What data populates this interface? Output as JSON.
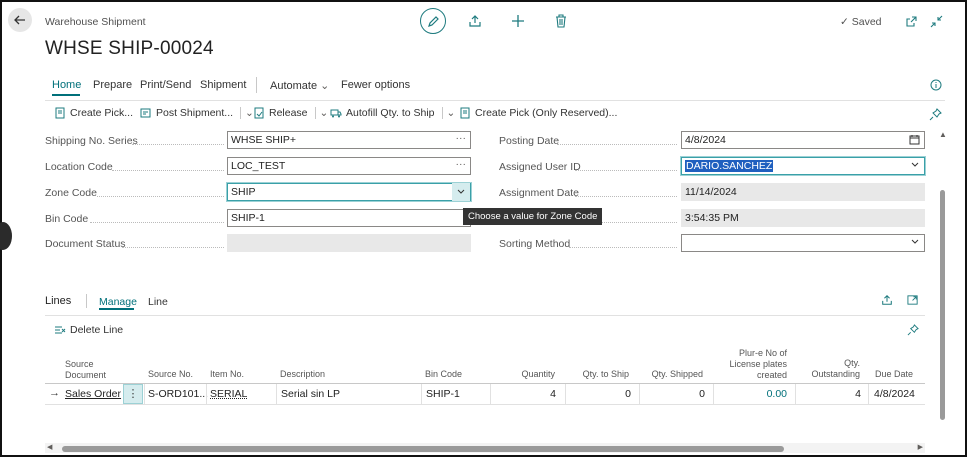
{
  "header": {
    "page_kind": "Warehouse Shipment",
    "title": "WHSE SHIP-00024",
    "saved_label": "Saved"
  },
  "tabs": [
    "Home",
    "Prepare",
    "Print/Send",
    "Shipment",
    "Automate",
    "Fewer options"
  ],
  "commands": [
    "Create Pick...",
    "Post Shipment...",
    "Release",
    "Autofill Qty. to Ship",
    "Create Pick (Only Reserved)..."
  ],
  "left_fields": [
    {
      "label": "Shipping No. Series",
      "value": "WHSE SHIP+"
    },
    {
      "label": "Location Code",
      "value": "LOC_TEST"
    },
    {
      "label": "Zone Code",
      "value": "SHIP"
    },
    {
      "label": "Bin Code",
      "value": "SHIP-1"
    },
    {
      "label": "Document Status",
      "value": ""
    }
  ],
  "right_fields": [
    {
      "label": "Posting Date",
      "value": "4/8/2024"
    },
    {
      "label": "Assigned User ID",
      "value": "DARIO.SANCHEZ"
    },
    {
      "label": "Assignment Date",
      "value": "11/14/2024"
    },
    {
      "label": "",
      "value": "3:54:35 PM"
    },
    {
      "label": "Sorting Method",
      "value": ""
    }
  ],
  "tooltip": "Choose a value for Zone Code",
  "lines": {
    "title": "Lines",
    "tabs": [
      "Manage",
      "Line"
    ],
    "delete_label": "Delete Line",
    "columns": [
      "Source Document",
      "Source No.",
      "Item No.",
      "Description",
      "Bin Code",
      "Quantity",
      "Qty. to Ship",
      "Qty. Shipped",
      "Plur-e No of License plates created",
      "Qty. Outstanding",
      "Due Date"
    ],
    "row": {
      "source_document": "Sales Order",
      "source_no": "S-ORD101...",
      "item_no": "SERIAL",
      "description": "Serial sin LP",
      "bin_code": "SHIP-1",
      "quantity": "4",
      "qty_to_ship": "0",
      "qty_shipped": "0",
      "lp_created": "0.00",
      "qty_outstanding": "4",
      "due_date": "4/8/2024"
    }
  }
}
